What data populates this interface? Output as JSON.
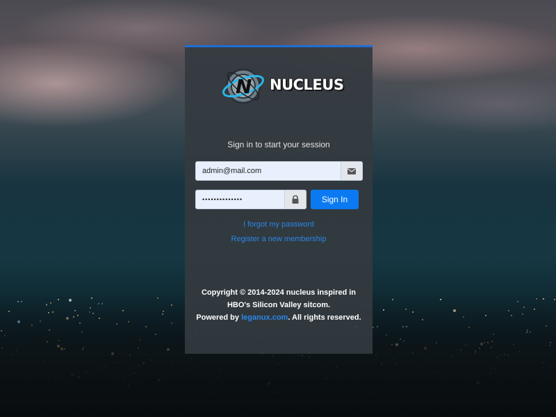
{
  "login": {
    "logo_text": "NUCLEUS",
    "message": "Sign in to start your session",
    "email_value": "admin@mail.com",
    "password_value": "••••••••••••••",
    "signin_label": "Sign In",
    "forgot_label": "I forgot my password",
    "register_label": "Register a new membership"
  },
  "footer": {
    "copyright_line1": "Copyright © 2014-2024 nucleus inspired in",
    "copyright_line2": "HBO's Silicon Valley sitcom.",
    "powered_by": "Powered by",
    "powered_link": "leganux.com",
    "rights": ". All rights reserved."
  },
  "icons": {
    "email": "envelope-icon",
    "password": "lock-icon"
  },
  "colors": {
    "accent": "#0b7af2",
    "link": "#2c86e8",
    "panel": "#343a40",
    "panel_border": "#1e6fd6"
  }
}
